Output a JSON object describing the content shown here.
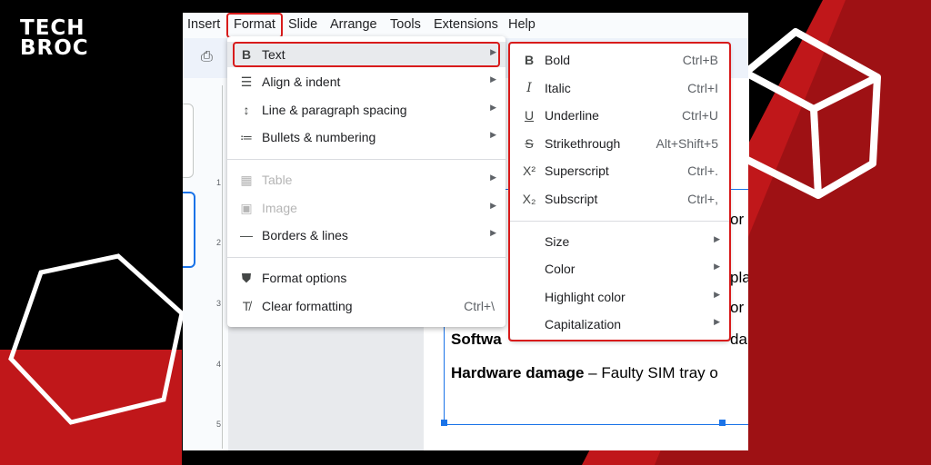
{
  "brand": {
    "line1": "TECH",
    "line2": "BROC"
  },
  "colors": {
    "accent_red": "#d81b1b",
    "highlight_box": "#d81b1b",
    "background": "#000000"
  },
  "menubar": {
    "items": [
      "Insert",
      "Format",
      "Slide",
      "Arrange",
      "Tools",
      "Extensions",
      "Help"
    ]
  },
  "format_menu": {
    "items": [
      {
        "label": "Text",
        "icon": "bold-b-icon",
        "submenu": true
      },
      {
        "label": "Align & indent",
        "icon": "align-indent-icon",
        "submenu": true
      },
      {
        "label": "Line & paragraph spacing",
        "icon": "line-spacing-icon",
        "submenu": true
      },
      {
        "label": "Bullets & numbering",
        "icon": "bullets-icon",
        "submenu": true
      },
      {
        "label": "Table",
        "icon": "table-icon",
        "submenu": true,
        "disabled": true
      },
      {
        "label": "Image",
        "icon": "image-icon",
        "submenu": true,
        "disabled": true
      },
      {
        "label": "Borders & lines",
        "icon": "border-line-icon",
        "submenu": true
      },
      {
        "label": "Format options",
        "icon": "paint-roller-icon"
      },
      {
        "label": "Clear formatting",
        "icon": "clear-format-icon",
        "shortcut": "Ctrl+\\"
      }
    ]
  },
  "text_submenu": {
    "items": [
      {
        "label": "Bold",
        "icon": "bold-icon",
        "shortcut": "Ctrl+B"
      },
      {
        "label": "Italic",
        "icon": "italic-icon",
        "shortcut": "Ctrl+I"
      },
      {
        "label": "Underline",
        "icon": "underline-icon",
        "shortcut": "Ctrl+U"
      },
      {
        "label": "Strikethrough",
        "icon": "strikethrough-icon",
        "shortcut": "Alt+Shift+5"
      },
      {
        "label": "Superscript",
        "icon": "superscript-icon",
        "shortcut": "Ctrl+."
      },
      {
        "label": "Subscript",
        "icon": "subscript-icon",
        "shortcut": "Ctrl+,"
      },
      {
        "label": "Size",
        "submenu": true
      },
      {
        "label": "Color",
        "submenu": true
      },
      {
        "label": "Highlight color",
        "submenu": true
      },
      {
        "label": "Capitalization",
        "submenu": true
      }
    ]
  },
  "slide": {
    "frag_or1": "or",
    "frag_pla": "pla",
    "frag_or2": "or",
    "software_bold": "Softwa",
    "frag_da": "da",
    "hardware_bold": "Hardware damage",
    "hardware_rest": " – Faulty SIM tray o"
  },
  "ruler": {
    "labels": [
      "1",
      "2",
      "3",
      "4",
      "5"
    ]
  }
}
